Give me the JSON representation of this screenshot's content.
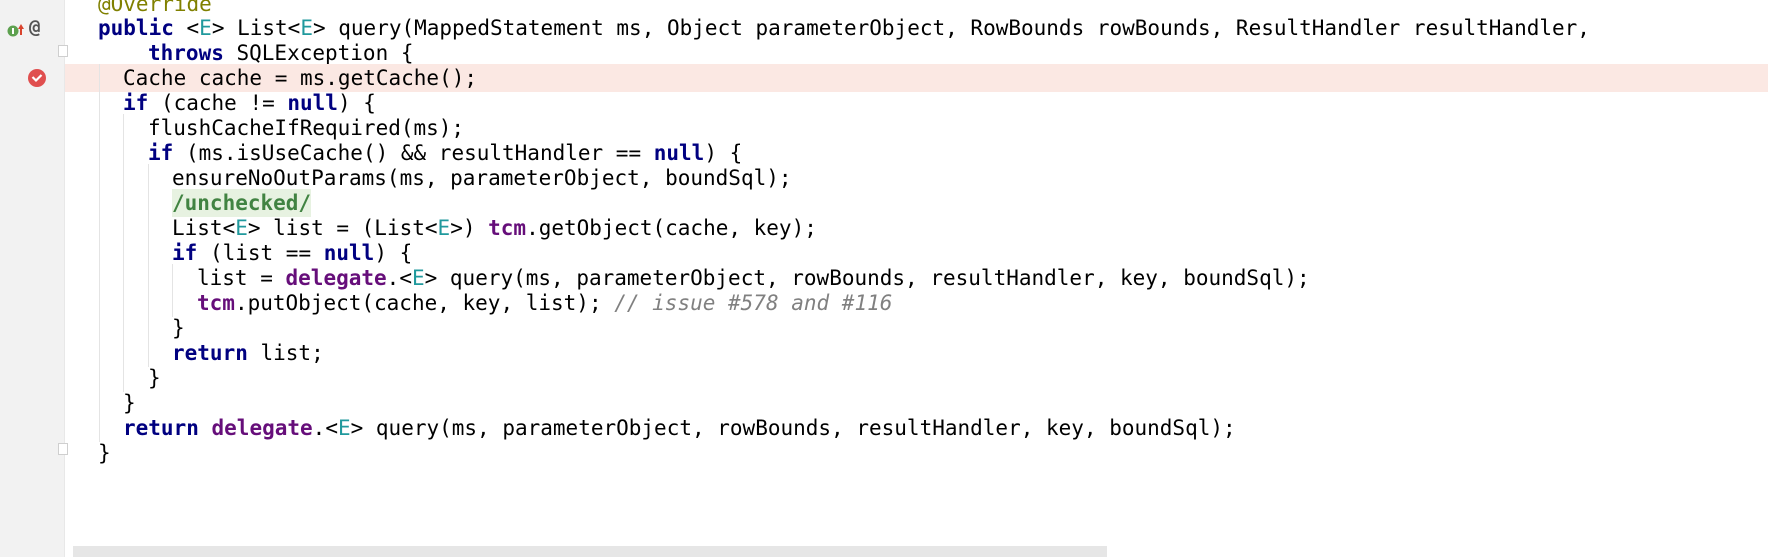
{
  "code_lines": [
    "@Override",
    "public <E> List<E> query(MappedStatement ms, Object parameterObject, RowBounds rowBounds, ResultHandler resultHandler,",
    "    throws SQLException {",
    "Cache cache = ms.getCache();",
    "if (cache != null) {",
    "flushCacheIfRequired(ms);",
    "if (ms.isUseCache() && resultHandler == null) {",
    "ensureNoOutParams(ms, parameterObject, boundSql);",
    "/unchecked/",
    "List<E> list = (List<E>) tcm.getObject(cache, key);",
    "if (list == null) {",
    "list = delegate.<E> query(ms, parameterObject, rowBounds, resultHandler, key, boundSql);",
    "tcm.putObject(cache, key, list); // issue #578 and #116",
    "}",
    "return list;",
    "}",
    "}",
    "return delegate.<E> query(ms, parameterObject, rowBounds, resultHandler, key, boundSql);",
    "}"
  ],
  "gutter_icons": {
    "override_marker": "implements-up-arrow-icon",
    "annotation_marker": "@",
    "breakpoint": "breakpoint-check-icon"
  },
  "colors": {
    "keyword": "#000080",
    "type_param": "#20999d",
    "field": "#660e7a",
    "annotation": "#808000",
    "comment": "#808080",
    "highlight_line": "#fbe8e3",
    "breakpoint": "#e04f4f"
  }
}
